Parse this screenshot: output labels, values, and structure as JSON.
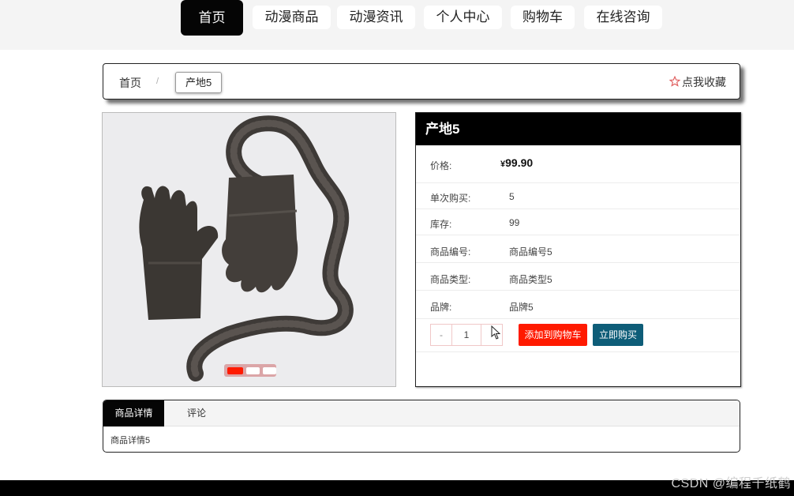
{
  "nav": {
    "items": [
      {
        "label": "首页",
        "active": true
      },
      {
        "label": "动漫商品",
        "active": false
      },
      {
        "label": "动漫资讯",
        "active": false
      },
      {
        "label": "个人中心",
        "active": false
      },
      {
        "label": "购物车",
        "active": false
      },
      {
        "label": "在线咨询",
        "active": false
      }
    ]
  },
  "breadcrumb": {
    "home": "首页",
    "separator": "/",
    "current": "产地5",
    "favorite": "点我收藏"
  },
  "gallery": {
    "slides": 3,
    "active_slide": 1
  },
  "product": {
    "title": "产地5",
    "price_label": "价格:",
    "price_currency": "¥",
    "price_value": "99.90",
    "single_label": "单次购买:",
    "single_value": "5",
    "stock_label": "库存:",
    "stock_value": "99",
    "code_label": "商品编号:",
    "code_value": "商品编号5",
    "type_label": "商品类型:",
    "type_value": "商品类型5",
    "brand_label": "品牌:",
    "brand_value": "品牌5",
    "qty_minus": "-",
    "qty_value": "1",
    "add_to_cart": "添加到购物车",
    "buy_now": "立即购买"
  },
  "tabs": {
    "items": [
      "商品详情",
      "评论"
    ],
    "content": "商品详情5"
  },
  "footer": {
    "watermark": "CSDN @编程千纸鹤"
  },
  "colors": {
    "nav_active": "#050505",
    "cart_button": "#ff1a00",
    "buy_button": "#0e5d78",
    "favorite_star": "#e06060"
  }
}
